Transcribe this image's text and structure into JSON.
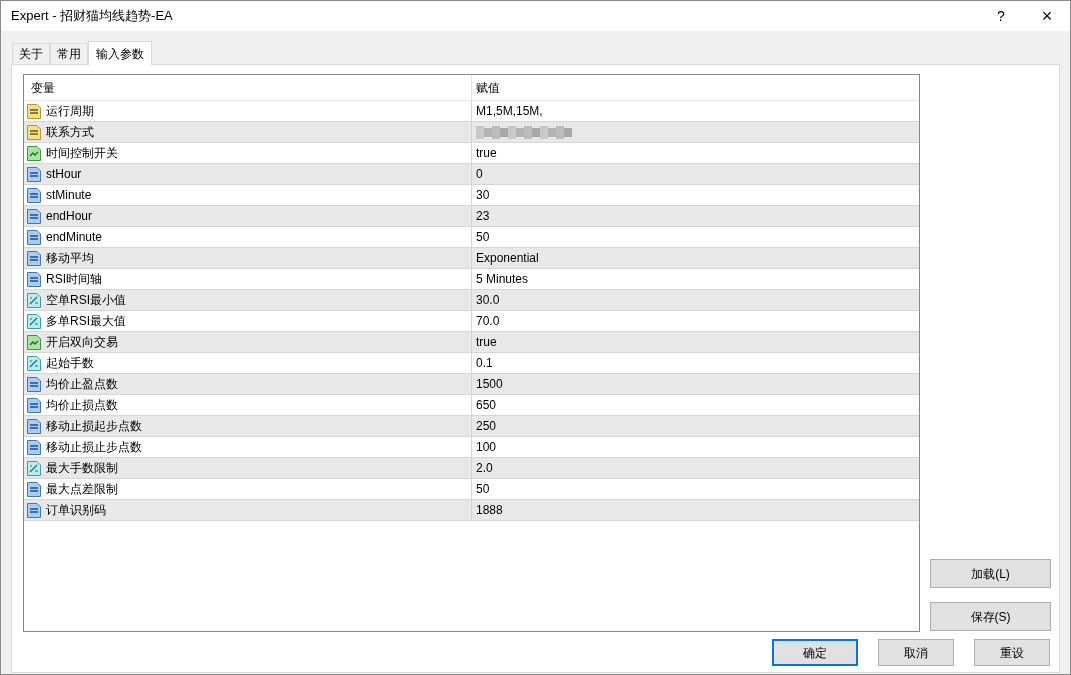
{
  "window": {
    "title": "Expert - 招财猫均线趋势-EA",
    "help_button": "?",
    "close_button": "×"
  },
  "tabs": [
    {
      "label": "关于",
      "selected": false
    },
    {
      "label": "常用",
      "selected": false
    },
    {
      "label": "输入参数",
      "selected": true
    }
  ],
  "table": {
    "columns": [
      "变量",
      "赋值"
    ],
    "rows": [
      {
        "kind": "string",
        "name": "运行周期",
        "value": "M1,5M,15M,"
      },
      {
        "kind": "string",
        "name": "联系方式",
        "redacted": true
      },
      {
        "kind": "bool",
        "name": "时间控制开关",
        "value": "true"
      },
      {
        "kind": "int",
        "name": "stHour",
        "value": "0"
      },
      {
        "kind": "int",
        "name": "stMinute",
        "value": "30"
      },
      {
        "kind": "int",
        "name": "endHour",
        "value": "23"
      },
      {
        "kind": "int",
        "name": "endMinute",
        "value": "50"
      },
      {
        "kind": "int",
        "name": "移动平均",
        "value": "Exponential"
      },
      {
        "kind": "int",
        "name": "RSI时间轴",
        "value": "5 Minutes"
      },
      {
        "kind": "double",
        "name": "空单RSI最小值",
        "value": "30.0"
      },
      {
        "kind": "double",
        "name": "多单RSI最大值",
        "value": "70.0"
      },
      {
        "kind": "bool",
        "name": "开启双向交易",
        "value": "true"
      },
      {
        "kind": "double",
        "name": "起始手数",
        "value": "0.1"
      },
      {
        "kind": "int",
        "name": "均价止盈点数",
        "value": "1500"
      },
      {
        "kind": "int",
        "name": "均价止损点数",
        "value": "650"
      },
      {
        "kind": "int",
        "name": "移动止损起步点数",
        "value": "250"
      },
      {
        "kind": "int",
        "name": "移动止损止步点数",
        "value": "100"
      },
      {
        "kind": "double",
        "name": "最大手数限制",
        "value": "2.0"
      },
      {
        "kind": "int",
        "name": "最大点差限制",
        "value": "50"
      },
      {
        "kind": "int",
        "name": "订单识别码",
        "value": "1888"
      }
    ]
  },
  "side_buttons": [
    "加载(L)",
    "保存(S)"
  ],
  "bottom_buttons": [
    {
      "label": "确定",
      "selected": true
    },
    {
      "label": "取消",
      "selected": false
    },
    {
      "label": "重设",
      "selected": false
    }
  ]
}
